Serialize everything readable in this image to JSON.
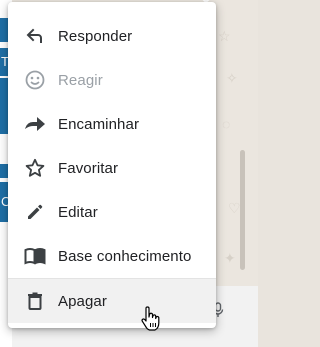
{
  "background": {
    "left_letters": [
      "T",
      "C"
    ]
  },
  "menu": {
    "items": [
      {
        "label": "Responder",
        "icon": "reply-icon",
        "enabled": true
      },
      {
        "label": "Reagir",
        "icon": "emoji-icon",
        "enabled": false
      },
      {
        "label": "Encaminhar",
        "icon": "forward-icon",
        "enabled": true
      },
      {
        "label": "Favoritar",
        "icon": "star-icon",
        "enabled": true
      },
      {
        "label": "Editar",
        "icon": "pencil-icon",
        "enabled": true
      },
      {
        "label": "Base conhecimento",
        "icon": "book-icon",
        "enabled": true
      },
      {
        "label": "Apagar",
        "icon": "trash-icon",
        "enabled": true,
        "hovered": true
      }
    ]
  },
  "colors": {
    "accent": "#1f6fa6",
    "icon": "#3c4043",
    "disabled": "#9aa0a6"
  }
}
